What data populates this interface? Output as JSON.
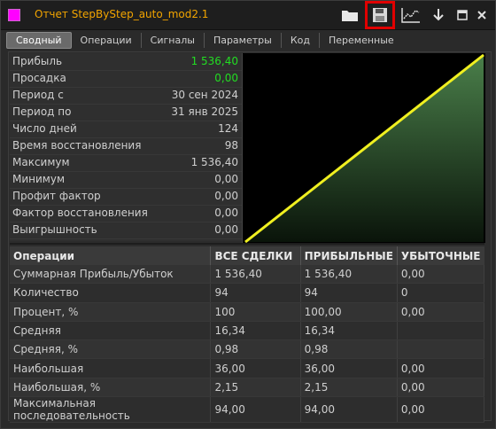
{
  "window": {
    "title": "Отчет StepByStep_auto_mod2.1"
  },
  "toolbar": {
    "open_icon": "folder-icon",
    "save_icon": "floppy-disk-icon",
    "chart_icon": "chart-icon",
    "download_icon": "arrow-down-icon",
    "minimize_icon": "minimize-icon",
    "close_icon": "close-icon"
  },
  "tabs": [
    "Сводный",
    "Операции",
    "Сигналы",
    "Параметры",
    "Код",
    "Переменные"
  ],
  "summary": [
    {
      "label": "Прибыль",
      "value": "1 536,40",
      "highlight": true
    },
    {
      "label": "Просадка",
      "value": "0,00",
      "highlight": true
    },
    {
      "label": "Период с",
      "value": "30 сен 2024"
    },
    {
      "label": "Период по",
      "value": "31 янв 2025"
    },
    {
      "label": "Число дней",
      "value": "124"
    },
    {
      "label": "Время восстановления",
      "value": "98"
    },
    {
      "label": "Максимум",
      "value": "1 536,40"
    },
    {
      "label": "Минимум",
      "value": "0,00"
    },
    {
      "label": "Профит фактор",
      "value": "0,00"
    },
    {
      "label": "Фактор восстановления",
      "value": "0,00"
    },
    {
      "label": "Выигрышность",
      "value": "0,00"
    }
  ],
  "chart_data": {
    "type": "area",
    "x": [
      0,
      1
    ],
    "values": [
      0,
      1536.4
    ],
    "line_color": "#f0f020",
    "fill_color": "#4a7f4a"
  },
  "stats": {
    "headers": [
      "Операции",
      "ВСЕ СДЕЛКИ",
      "ПРИБЫЛЬНЫЕ",
      "УБЫТОЧНЫЕ"
    ],
    "rows": [
      [
        "Суммарная Прибыль/Убыток",
        "1 536,40",
        "1 536,40",
        "0,00"
      ],
      [
        "Количество",
        "94",
        "94",
        "0"
      ],
      [
        "Процент, %",
        "100",
        "100,00",
        "0,00"
      ],
      [
        "Средняя",
        "16,34",
        "16,34",
        ""
      ],
      [
        "Средняя, %",
        "0,98",
        "0,98",
        ""
      ],
      [
        "Наибольшая",
        "36,00",
        "36,00",
        "0,00"
      ],
      [
        "Наибольшая, %",
        "2,15",
        "2,15",
        "0,00"
      ],
      [
        "Максимальная последовательность",
        "94,00",
        "94,00",
        "0,00"
      ]
    ]
  }
}
